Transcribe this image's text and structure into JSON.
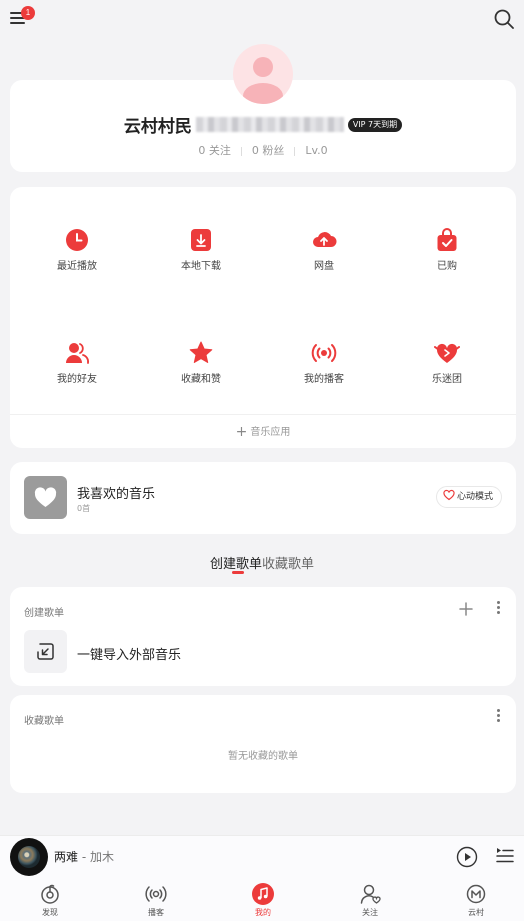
{
  "header": {
    "menu_icon": "menu-icon",
    "menu_badge": "1",
    "search_icon": "search-icon"
  },
  "profile": {
    "username": "云村村民",
    "username_obscured": true,
    "vip_badge": "VIP 7天到期",
    "follow": "0 关注",
    "fans": "0 粉丝",
    "level": "Lv.0"
  },
  "apps": [
    {
      "label": "最近播放",
      "icon": "clock-icon"
    },
    {
      "label": "本地下载",
      "icon": "download-icon"
    },
    {
      "label": "网盘",
      "icon": "cloud-upload-icon"
    },
    {
      "label": "已购",
      "icon": "shopping-bag-icon"
    },
    {
      "label": "我的好友",
      "icon": "friends-icon"
    },
    {
      "label": "收藏和赞",
      "icon": "star-icon"
    },
    {
      "label": "我的播客",
      "icon": "podcast-icon"
    },
    {
      "label": "乐迷团",
      "icon": "fan-club-icon"
    }
  ],
  "add_apps_label": "音乐应用",
  "favorites": {
    "title": "我喜欢的音乐",
    "count": "0首",
    "heart_mode_label": "心动模式"
  },
  "playlist_tabs": {
    "created": "创建歌单",
    "collected": "收藏歌单"
  },
  "created_section": {
    "title": "创建歌单",
    "import_label": "一键导入外部音乐"
  },
  "collected_section": {
    "title": "收藏歌单",
    "empty_text": "暂无收藏的歌单"
  },
  "player": {
    "song": "两难",
    "artist": "加木",
    "separator": " - "
  },
  "nav": [
    {
      "label": "发现",
      "icon": "discover-icon",
      "active": false
    },
    {
      "label": "播客",
      "icon": "podcast-nav-icon",
      "active": false
    },
    {
      "label": "我的",
      "icon": "music-note-icon",
      "active": true
    },
    {
      "label": "关注",
      "icon": "follow-icon",
      "active": false
    },
    {
      "label": "云村",
      "icon": "cloud-village-icon",
      "active": false
    }
  ],
  "colors": {
    "accent": "#ec3b3b",
    "background": "#f3f3f5",
    "card": "#ffffff",
    "text_primary": "#222222",
    "text_secondary": "#999999"
  }
}
